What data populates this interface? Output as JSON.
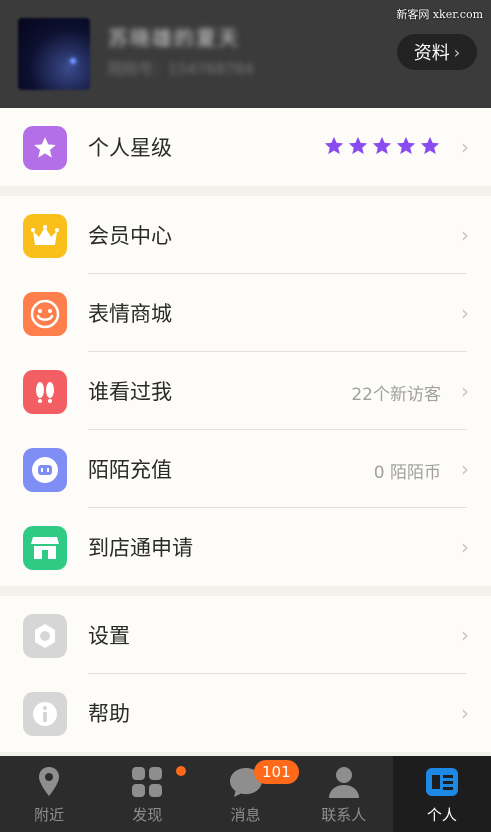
{
  "watermark": "新客网 xker.com",
  "profile": {
    "name": "苏晓雄的夏天",
    "id_text": "陌陌号：154768784",
    "details_button": "资料"
  },
  "rating": {
    "label": "个人星级",
    "stars": 5,
    "star_color": "#8a4cf0"
  },
  "menu_group_1": [
    {
      "label": "会员中心",
      "icon": "crown-icon",
      "color": "#fbbf1b",
      "value": ""
    },
    {
      "label": "表情商城",
      "icon": "smiley-icon",
      "color": "#ff7f4c",
      "value": ""
    },
    {
      "label": "谁看过我",
      "icon": "footprints-icon",
      "color": "#f35e63",
      "value": "22个新访客"
    },
    {
      "label": "陌陌充值",
      "icon": "coin-icon",
      "color": "#7f8ef4",
      "value": "0 陌陌币"
    },
    {
      "label": "到店通申请",
      "icon": "store-icon",
      "color": "#2fcb85",
      "value": ""
    }
  ],
  "menu_group_2": [
    {
      "label": "设置",
      "icon": "gear-icon",
      "color": "#d6d6d6"
    },
    {
      "label": "帮助",
      "icon": "info-icon",
      "color": "#d6d6d6"
    }
  ],
  "tabs": [
    {
      "label": "附近",
      "icon": "location-pin-icon"
    },
    {
      "label": "发现",
      "icon": "grid-icon",
      "has_dot": true
    },
    {
      "label": "消息",
      "icon": "chat-bubble-icon",
      "badge": "101"
    },
    {
      "label": "联系人",
      "icon": "contact-person-icon"
    },
    {
      "label": "个人",
      "icon": "profile-card-icon",
      "active": true
    }
  ],
  "colors": {
    "header_bg": "#3b3b3b",
    "tabbar_bg": "#2c2c2c",
    "badge": "#ff6a1a",
    "active_tab_icon": "#1e88e5"
  }
}
